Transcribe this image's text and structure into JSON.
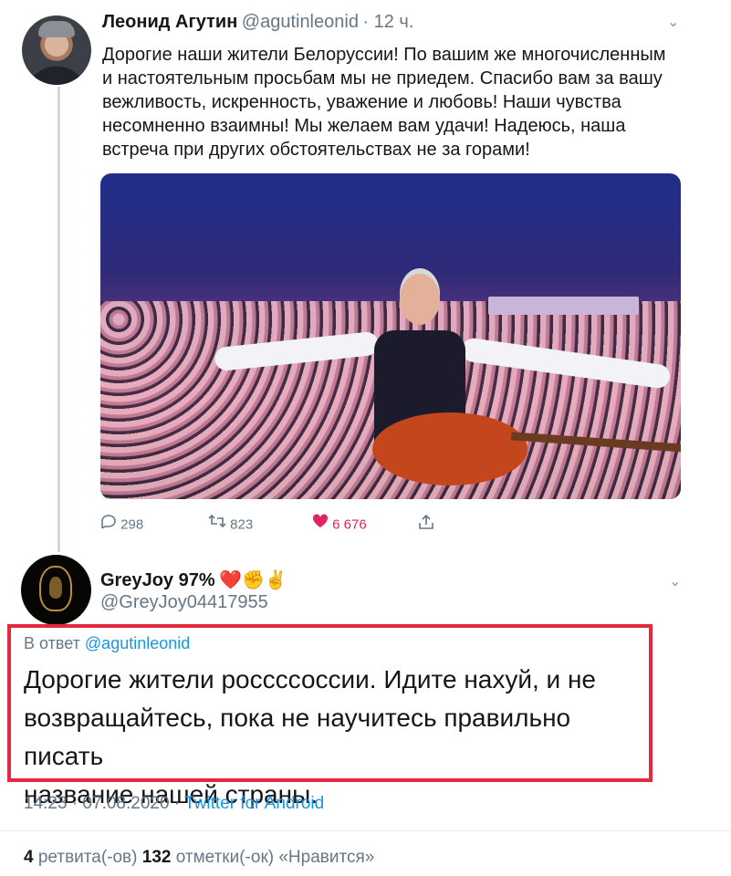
{
  "tweet": {
    "author_name": "Леонид Агутин",
    "handle": "@agutinleonid",
    "time": "· 12 ч.",
    "text_lines": [
      "Дорогие наши жители Белоруссии! По вашим же многочисленным",
      "и настоятельным просьбам мы не приедем. Спасибо вам за вашу",
      "вежливость, искренность, уважение и любовь! Наши чувства",
      "несомненно взаимны! Мы желаем вам удачи! Надеюсь, наша",
      "встреча при других обстоятельствах не за горами!"
    ],
    "replies": "298",
    "retweets": "823",
    "likes": "6 676"
  },
  "reply": {
    "author_name": "GreyJoy 97%",
    "author_emojis": "❤️✊✌️",
    "handle": "@GreyJoy04417955",
    "in_reply_label": "В ответ",
    "in_reply_to": "@agutinleonid",
    "text_lines": [
      "Дорогие жители россссоссии. Идите нахуй, и не",
      "возвращайтесь, пока не научитесь правильно писать",
      "название нашей страны."
    ],
    "timestamp": "14:23 · 07.08.2020 ·",
    "source": "Twitter for Android",
    "retweets_count": "4",
    "retweets_label": "ретвита(-ов)",
    "likes_count": "132",
    "likes_label": "отметки(-ок) «Нравится»"
  },
  "icons": {
    "reply": "reply-icon",
    "retweet": "retweet-icon",
    "like": "heart-icon",
    "share": "share-icon",
    "menu": "chevron-down-icon"
  },
  "colors": {
    "link": "#1b95e0",
    "highlight_border": "#e3283f",
    "like": "#e0245e"
  }
}
